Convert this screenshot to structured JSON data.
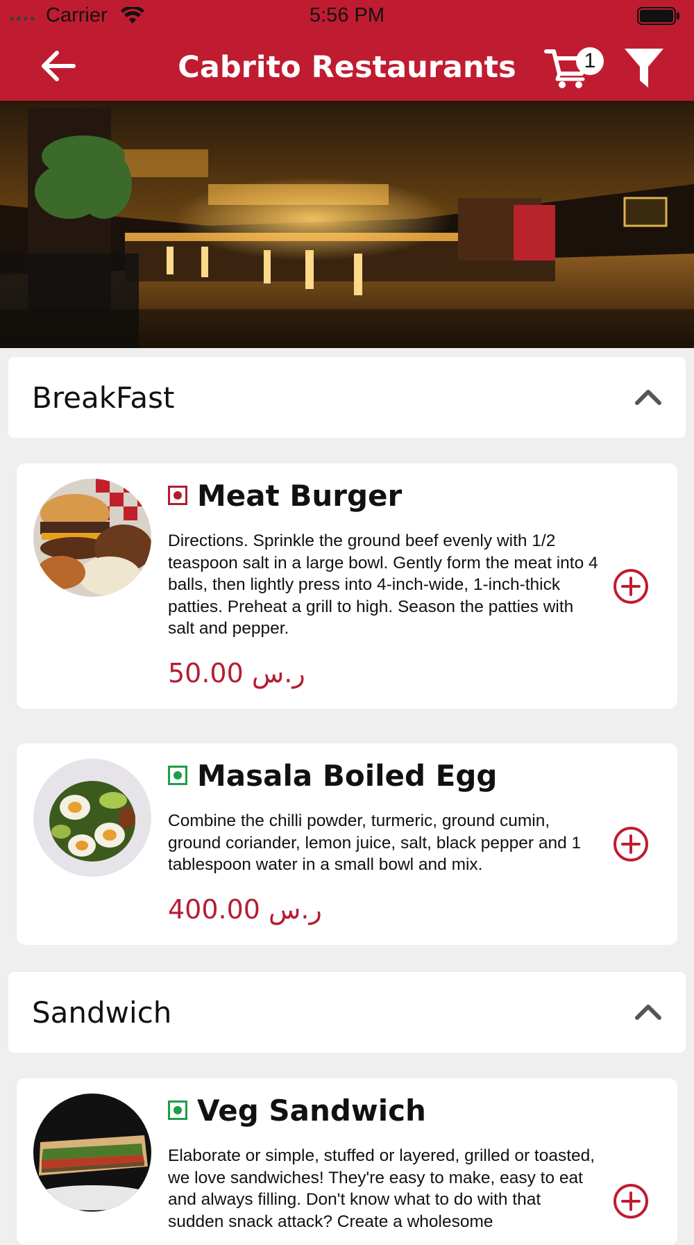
{
  "status_bar": {
    "carrier": "Carrier",
    "time": "5:56 PM"
  },
  "nav": {
    "title": "Cabrito Restaurants",
    "cart_count": "1"
  },
  "colors": {
    "brand_red": "#c01c31",
    "price_red": "#b51d33",
    "veg_green": "#1e9e4a",
    "nonveg_red": "#b01c2e"
  },
  "sections": [
    {
      "title": "BreakFast",
      "items": [
        {
          "name": "Meat Burger",
          "type": "non-veg",
          "description": "Directions. Sprinkle the ground beef evenly with 1/2 teaspoon salt in a large bowl. Gently form the meat into 4 balls, then lightly press into 4-inch-wide, 1-inch-thick patties. Preheat a grill to high. Season the patties with salt and pepper.",
          "price": "50.00 ر.س"
        },
        {
          "name": "Masala Boiled Egg",
          "type": "veg",
          "description": "Combine the chilli powder, turmeric, ground cumin, ground coriander, lemon juice, salt, black pepper and 1 tablespoon water in a small bowl and mix.",
          "price": "400.00 ر.س"
        }
      ]
    },
    {
      "title": "Sandwich",
      "items": [
        {
          "name": "Veg Sandwich",
          "type": "veg",
          "description": "Elaborate or simple, stuffed or layered, grilled or toasted, we love sandwiches! They're easy to make, easy to eat and always filling. Don't know what to do with that sudden snack attack? Create a wholesome"
        }
      ]
    }
  ]
}
